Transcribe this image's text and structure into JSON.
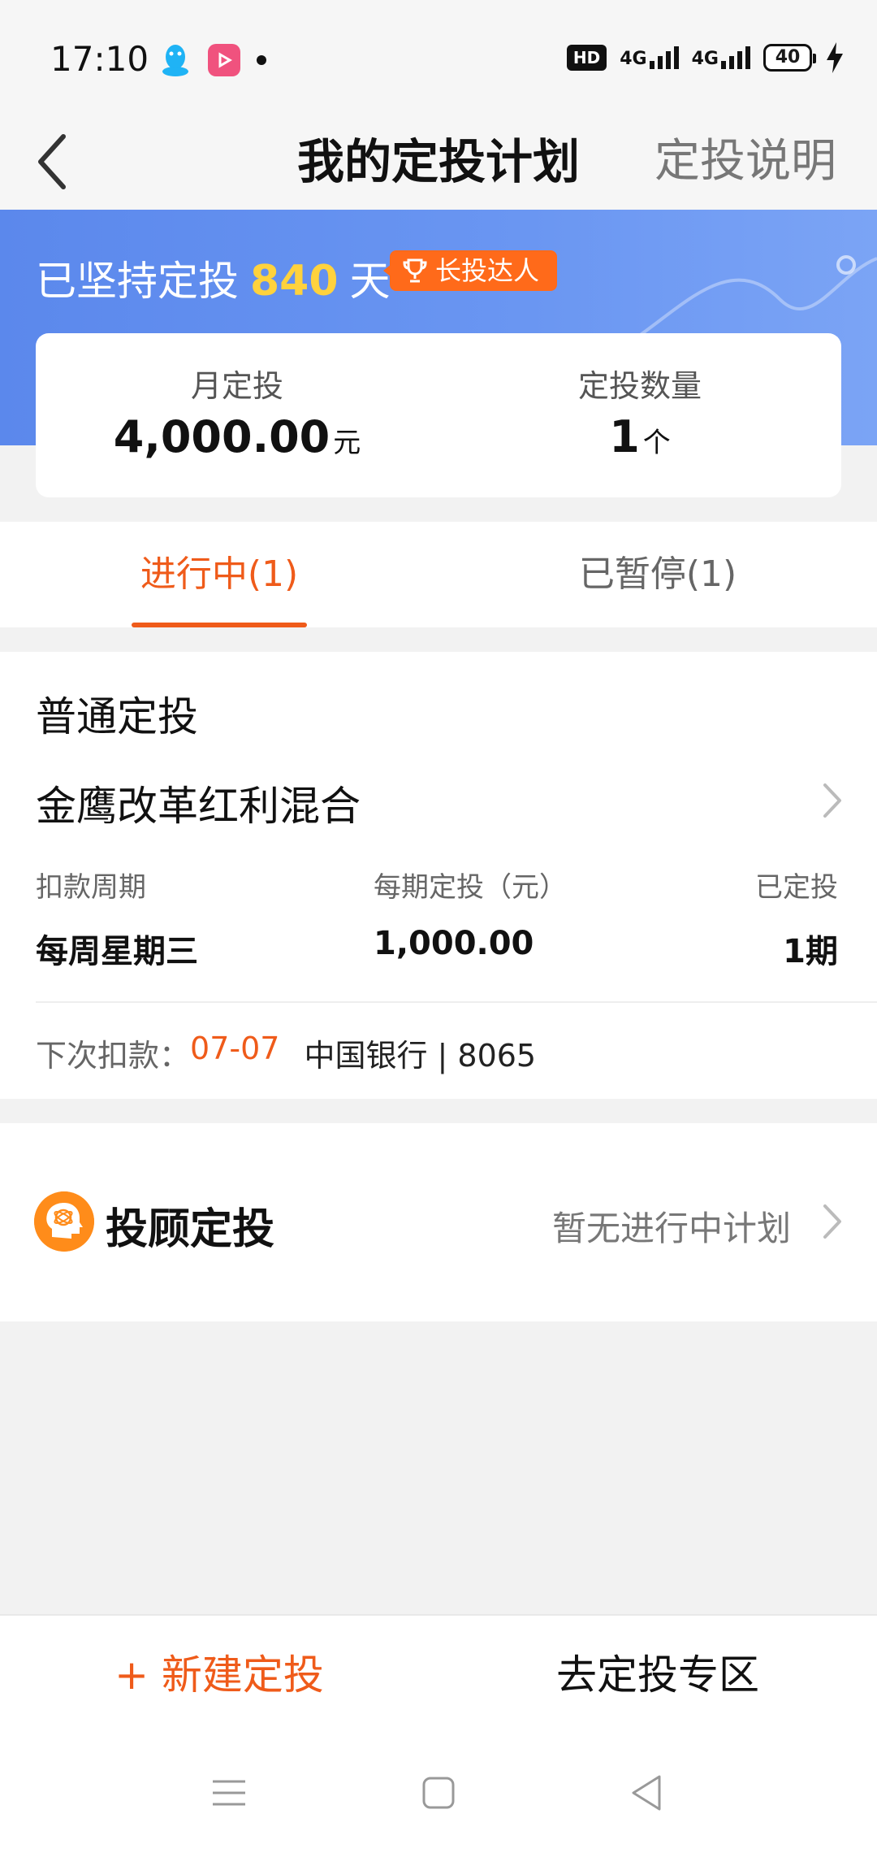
{
  "status_bar": {
    "time": "17:10",
    "hd_label": "HD",
    "network1": "4G",
    "network2": "4G",
    "battery": "40",
    "icons": [
      "qq-icon",
      "app-icon",
      "notification-dot",
      "signal-icon",
      "battery-icon",
      "charging-icon"
    ]
  },
  "header": {
    "title": "我的定投计划",
    "right_link": "定投说明",
    "back_icon": "chevron-left-icon"
  },
  "banner": {
    "streak_prefix": "已坚持定投",
    "streak_days": "840",
    "streak_suffix": "天",
    "badge_label": "长投达人",
    "badge_icon": "trophy-icon"
  },
  "summary": {
    "monthly_label": "月定投",
    "monthly_value": "4,000.00",
    "monthly_unit": "元",
    "count_label": "定投数量",
    "count_value": "1",
    "count_unit": "个"
  },
  "tabs": {
    "active": "进行中(1)",
    "inactive": "已暂停(1)"
  },
  "plan": {
    "section_title": "普通定投",
    "fund_name": "金鹰改革红利混合",
    "col1_label": "扣款周期",
    "col2_label": "每期定投（元）",
    "col3_label": "已定投",
    "col1_value": "每周星期三",
    "col2_value": "1,000.00",
    "col3_value": "1期",
    "next_debit_label": "下次扣款：",
    "next_debit_date": "07-07",
    "bank": "中国银行 | 8065"
  },
  "advisor": {
    "title": "投顾定投",
    "status": "暂无进行中计划"
  },
  "bottom": {
    "new_plan": "+ 新建定投",
    "zone": "去定投专区"
  },
  "colors": {
    "accent": "#ef5b1a",
    "banner_blue": "#5b88ec",
    "streak_yellow": "#ffd23d",
    "badge_orange": "#ff6a1a"
  }
}
